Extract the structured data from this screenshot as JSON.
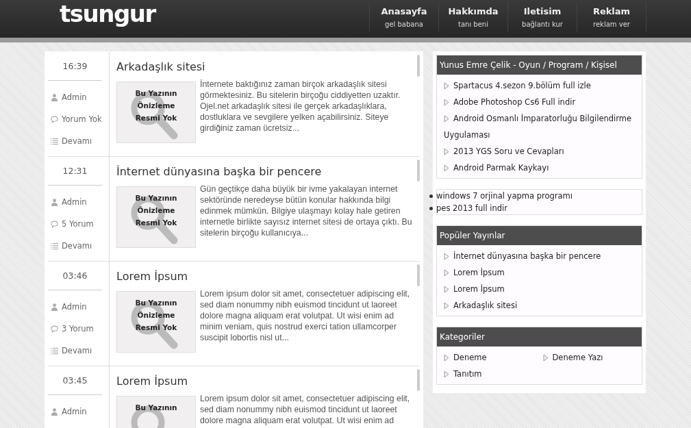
{
  "header": {
    "logo": "tsungur",
    "nav": [
      {
        "label": "Anasayfa",
        "sub": "gel babana"
      },
      {
        "label": "Hakkımda",
        "sub": "tanı beni"
      },
      {
        "label": "Iletisim",
        "sub": "bağlantı kur"
      },
      {
        "label": "Reklam",
        "sub": "reklam ver"
      }
    ]
  },
  "posts": [
    {
      "time": "16:39",
      "meta": [
        {
          "kind": "author",
          "text": "Admin"
        },
        {
          "kind": "comments",
          "text": "Yorum Yok"
        },
        {
          "kind": "more",
          "text": "Devamı"
        }
      ],
      "title": "Arkadaşlık sitesi",
      "thumb": [
        "Bu Yazının",
        "Önizleme",
        "Resmi Yok"
      ],
      "excerpt": "İnternete baktığınız zaman birçok arkadaşlık sitesi görmektesiniz. Bu sitelerin birçoğu ciddiyetten uzaktır. Ojel.net arkadaşlık sitesi ile gerçek arkadaşlıklara, dostluklara ve sevgilere yelken açabilirsiniz. Siteye girdiğiniz zaman ücretsiz..."
    },
    {
      "time": "12:31",
      "meta": [
        {
          "kind": "author",
          "text": "Admin"
        },
        {
          "kind": "comments",
          "text": "5 Yorum"
        },
        {
          "kind": "more",
          "text": "Devamı"
        }
      ],
      "title": "İnternet dünyasına başka bir pencere",
      "thumb": [
        "Bu Yazının",
        "Önizleme",
        "Resmi Yok"
      ],
      "excerpt": "Gün geçtikçe daha büyük bir ivme yakalayan internet sektöründe neredeyse bütün konular hakkında bilgi edinmek mümkün. Bilgiye ulaşmayı kolay hale getiren internetle birlikte sayısız internet sitesi de ortaya çıktı. Bu sitelerin birçoğu kullanıcıya..."
    },
    {
      "time": "03:46",
      "meta": [
        {
          "kind": "author",
          "text": "Admin"
        },
        {
          "kind": "comments",
          "text": "3 Yorum"
        },
        {
          "kind": "more",
          "text": "Devamı"
        }
      ],
      "title": "Lorem İpsum",
      "thumb": [
        "Bu Yazının",
        "Önizleme",
        "Resmi Yok"
      ],
      "excerpt": "Lorem ipsum dolor sit amet, consectetuer adipiscing elit, sed diam nonummy nibh euismod tincidunt ut laoreet dolore magna aliquam erat volutpat. Ut wisi enim ad minim veniam, quis nostrud exerci tation ullamcorper suscipit lobortis nisl ut..."
    },
    {
      "time": "03:45",
      "meta": [
        {
          "kind": "author",
          "text": "Admin"
        }
      ],
      "title": "Lorem İpsum",
      "thumb": [
        "Bu Yazının"
      ],
      "excerpt": "Lorem ipsum dolor sit amet, consectetuer adipiscing elit, sed diam nonummy nibh euismod tincidunt ut laoreet dolore magna aliquam erat volutpat. Ut wisi enim ad"
    }
  ],
  "sidebar": [
    {
      "kind": "list",
      "title": "Yunus Emre Çelik - Oyun / Program / Kişisel",
      "items": [
        "Spartacus 4.sezon 9.bölüm full izle",
        "Adobe Photoshop Cs6 Full indir",
        "Android Osmanlı İmparatorluğu Bilgilendirme Uygulaması",
        "2013 YGS Soru ve Cevapları",
        "Android Parmak Kaykayı"
      ]
    },
    {
      "kind": "bullets",
      "items": [
        "windows 7 orjinal yapma programı",
        "pes 2013 full indir"
      ]
    },
    {
      "kind": "list",
      "title": "Popüler Yayınlar",
      "items": [
        "İnternet dünyasına başka bir pencere",
        "Lorem İpsum",
        "Lorem İpsum",
        "Arkadaşlık sitesi"
      ]
    },
    {
      "kind": "columns",
      "title": "Kategoriler",
      "items": [
        "Deneme",
        "Deneme Yazı",
        "Tanıtım"
      ]
    }
  ]
}
